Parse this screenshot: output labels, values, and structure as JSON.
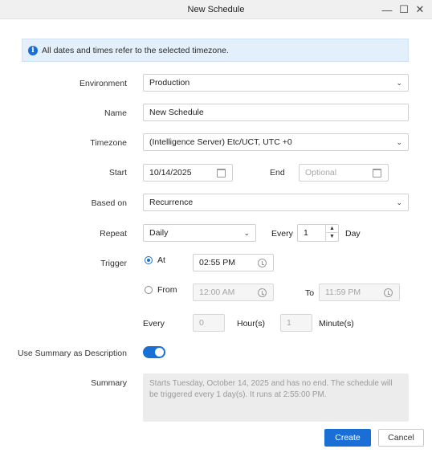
{
  "window": {
    "title": "New Schedule",
    "minimize": "—",
    "maximize": "☐",
    "close": "✕"
  },
  "banner": {
    "text": "All dates and times refer to the selected timezone."
  },
  "form": {
    "environment": {
      "label": "Environment",
      "value": "Production"
    },
    "name": {
      "label": "Name",
      "value": "New Schedule"
    },
    "timezone": {
      "label": "Timezone",
      "value": "(Intelligence Server) Etc/UCT, UTC +0"
    },
    "start": {
      "label": "Start",
      "value": "10/14/2025"
    },
    "end": {
      "label": "End",
      "placeholder": "Optional"
    },
    "based_on": {
      "label": "Based on",
      "value": "Recurrence"
    },
    "repeat": {
      "label": "Repeat",
      "value": "Daily",
      "every_label": "Every",
      "every_value": "1",
      "unit": "Day"
    },
    "trigger": {
      "label": "Trigger",
      "at_label": "At",
      "at_value": "02:55 PM",
      "from_label": "From",
      "from_value": "12:00 AM",
      "to_label": "To",
      "to_value": "11:59 PM",
      "every_label": "Every",
      "hours_value": "0",
      "hours_label": "Hour(s)",
      "minutes_value": "1",
      "minutes_label": "Minute(s)"
    },
    "use_summary": {
      "label": "Use Summary as Description",
      "enabled": true
    },
    "summary": {
      "label": "Summary",
      "text": "Starts Tuesday, October 14, 2025 and has no end. The schedule will be triggered every 1 day(s). It runs at 2:55:00 PM."
    }
  },
  "buttons": {
    "create": "Create",
    "cancel": "Cancel"
  },
  "colors": {
    "accent": "#1a6fd6",
    "banner_bg": "#e3effa"
  }
}
